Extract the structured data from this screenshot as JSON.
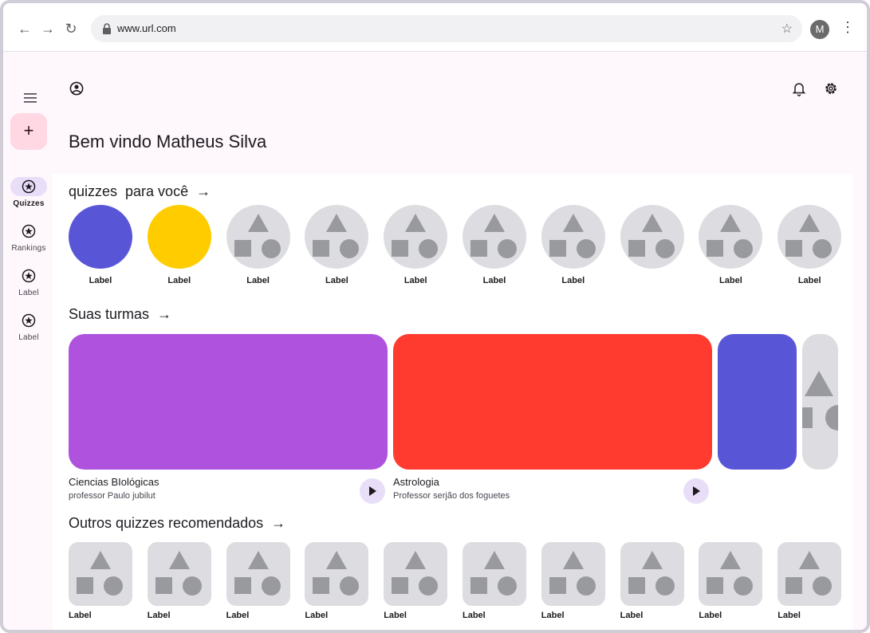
{
  "browser": {
    "url": "www.url.com",
    "profile_initial": "M"
  },
  "rail": {
    "fab_label": "+",
    "items": [
      {
        "label": "Quizzes",
        "active": true
      },
      {
        "label": "Rankings",
        "active": false
      },
      {
        "label": "Label",
        "active": false
      },
      {
        "label": "Label",
        "active": false
      }
    ]
  },
  "header": {
    "welcome": "Bem vindo Matheus Silva"
  },
  "quizzes_section": {
    "title": "quizzes  para você",
    "items": [
      {
        "label": "Label",
        "color": "#5856d6"
      },
      {
        "label": "Label",
        "color": "#ffcc00"
      },
      {
        "label": "Label"
      },
      {
        "label": "Label"
      },
      {
        "label": "Label"
      },
      {
        "label": "Label"
      },
      {
        "label": "Label"
      },
      {
        "label": ""
      },
      {
        "label": "Label"
      },
      {
        "label": "Label"
      }
    ]
  },
  "classes_section": {
    "title": "Suas turmas",
    "cards": [
      {
        "name": "Ciencias BIológicas",
        "professor": "professor Paulo jubilut",
        "color": "#af52de"
      },
      {
        "name": "Astrologia",
        "professor": "Professor serjão dos foguetes",
        "color": "#ff3b30"
      }
    ],
    "extra_card_color": "#5856d6"
  },
  "recommended_section": {
    "title": "Outros quizzes recomendados",
    "items": [
      {
        "label": "Label"
      },
      {
        "label": "Label"
      },
      {
        "label": "Label"
      },
      {
        "label": "Label"
      },
      {
        "label": "Label"
      },
      {
        "label": "Label"
      },
      {
        "label": "Label"
      },
      {
        "label": "Label"
      },
      {
        "label": "Label"
      },
      {
        "label": "Label"
      }
    ]
  },
  "colors": {
    "accent_container": "#e8def8",
    "fab": "#ffd8e4",
    "placeholder": "#dddde1",
    "placeholder_shape": "#999a9e"
  }
}
